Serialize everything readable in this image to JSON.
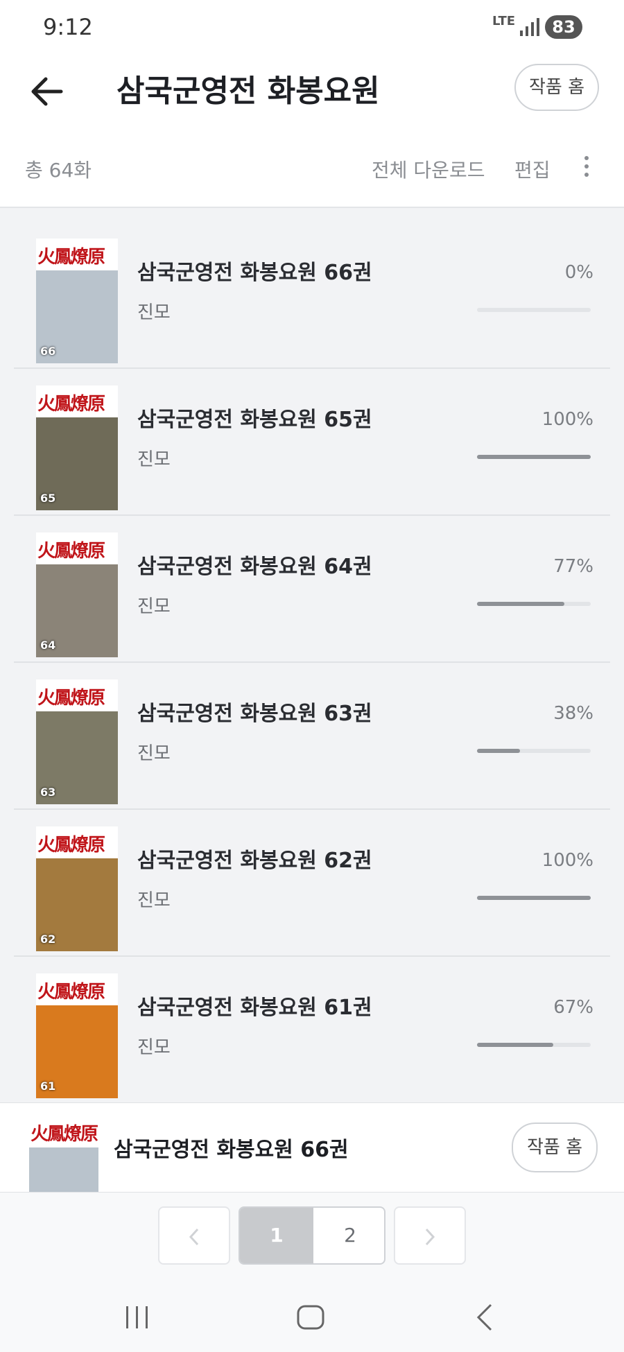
{
  "status_bar": {
    "time": "9:12",
    "network": "LTE",
    "battery": "83"
  },
  "header": {
    "title": "삼국군영전 화봉요원",
    "home_button": "작품 홈"
  },
  "toolbar": {
    "count": "총 64화",
    "download_all": "전체 다운로드",
    "edit": "편집"
  },
  "episodes": [
    {
      "title": "삼국군영전 화봉요원 66권",
      "author": "진모",
      "progress_label": "0%",
      "progress": 0,
      "cover_number": "66",
      "cover_logo": "火鳳燎原",
      "cover_color": "#b9c3cc"
    },
    {
      "title": "삼국군영전 화봉요원 65권",
      "author": "진모",
      "progress_label": "100%",
      "progress": 100,
      "cover_number": "65",
      "cover_logo": "火鳳燎原",
      "cover_color": "#6f6b58"
    },
    {
      "title": "삼국군영전 화봉요원 64권",
      "author": "진모",
      "progress_label": "77%",
      "progress": 77,
      "cover_number": "64",
      "cover_logo": "火鳳燎原",
      "cover_color": "#8b8478"
    },
    {
      "title": "삼국군영전 화봉요원 63권",
      "author": "진모",
      "progress_label": "38%",
      "progress": 38,
      "cover_number": "63",
      "cover_logo": "火鳳燎原",
      "cover_color": "#7d7a66"
    },
    {
      "title": "삼국군영전 화봉요원 62권",
      "author": "진모",
      "progress_label": "100%",
      "progress": 100,
      "cover_number": "62",
      "cover_logo": "火鳳燎原",
      "cover_color": "#a37a3e"
    },
    {
      "title": "삼국군영전 화봉요원 61권",
      "author": "진모",
      "progress_label": "67%",
      "progress": 67,
      "cover_number": "61",
      "cover_logo": "火鳳燎原",
      "cover_color": "#d97a1e"
    }
  ],
  "mini_player": {
    "title": "삼국군영전 화봉요원 66권",
    "home_button": "작품 홈",
    "cover_logo": "火鳳燎原"
  },
  "pagination": {
    "current": "1",
    "next_page": "2"
  }
}
